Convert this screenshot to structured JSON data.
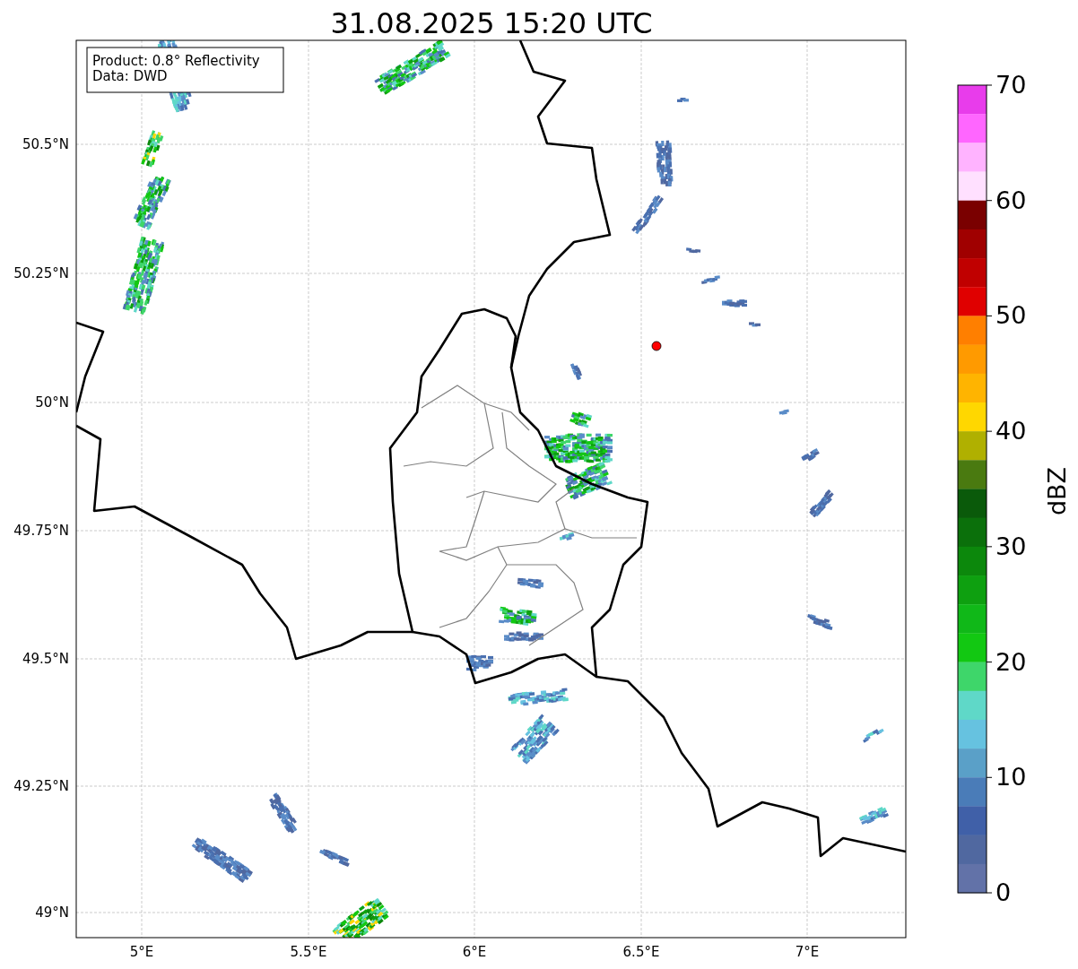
{
  "title": "31.08.2025 15:20 UTC",
  "annotation": [
    "Product: 0.8° Reflectivity",
    "Data: DWD"
  ],
  "x_tick_labels": [
    "5°E",
    "5.5°E",
    "6°E",
    "6.5°E",
    "7°E"
  ],
  "y_tick_labels": [
    "50.5°N",
    "50.25°N",
    "50°N",
    "49.75°N",
    "49.5°N",
    "49.25°N",
    "49°N"
  ],
  "colorbar": {
    "label": "dBZ",
    "tick_labels": [
      "70",
      "60",
      "50",
      "40",
      "30",
      "20",
      "10",
      "0"
    ],
    "segments": [
      {
        "color": "#e83ceb"
      },
      {
        "color": "#ff66ff"
      },
      {
        "color": "#ffb3ff"
      },
      {
        "color": "#ffe0ff"
      },
      {
        "color": "#7a0000"
      },
      {
        "color": "#a00000"
      },
      {
        "color": "#c00000"
      },
      {
        "color": "#e00000"
      },
      {
        "color": "#ff7f00"
      },
      {
        "color": "#ff9a00"
      },
      {
        "color": "#ffb400"
      },
      {
        "color": "#ffd700"
      },
      {
        "color": "#b0b000"
      },
      {
        "color": "#4a7a10"
      },
      {
        "color": "#0a5a0a"
      },
      {
        "color": "#0b700b"
      },
      {
        "color": "#0c880c"
      },
      {
        "color": "#0ea010"
      },
      {
        "color": "#10b818"
      },
      {
        "color": "#12c812"
      },
      {
        "color": "#3ed66a"
      },
      {
        "color": "#5fd8c8"
      },
      {
        "color": "#66c2e0"
      },
      {
        "color": "#5aa0c8"
      },
      {
        "color": "#4a7cb8"
      },
      {
        "color": "#4060a8"
      },
      {
        "color": "#5068a0"
      },
      {
        "color": "#6272a8"
      }
    ]
  }
}
